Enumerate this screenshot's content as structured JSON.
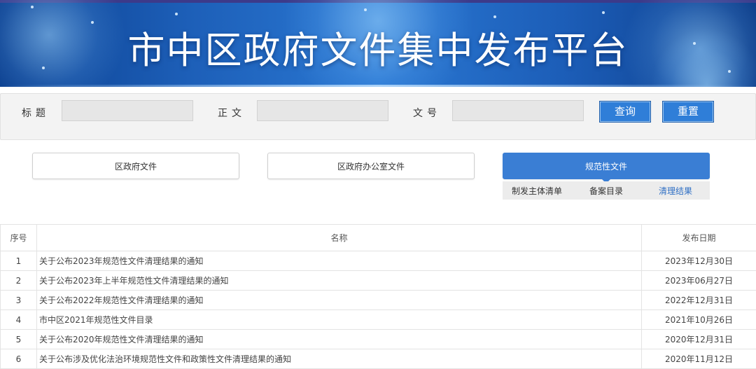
{
  "banner": {
    "title": "市中区政府文件集中发布平台"
  },
  "search": {
    "title_label": "标题",
    "body_label": "正文",
    "docno_label": "文号",
    "query_button": "查询",
    "reset_button": "重置"
  },
  "categories": {
    "tab1": "区政府文件",
    "tab2": "区政府办公室文件",
    "tab3": "规范性文件",
    "subtabs": [
      "制发主体清单",
      "备案目录",
      "清理结果"
    ],
    "active_subtab": "清理结果"
  },
  "table": {
    "headers": {
      "num": "序号",
      "name": "名称",
      "date": "发布日期"
    },
    "rows": [
      {
        "num": "1",
        "name": "关于公布2023年规范性文件清理结果的通知",
        "date": "2023年12月30日"
      },
      {
        "num": "2",
        "name": "关于公布2023年上半年规范性文件清理结果的通知",
        "date": "2023年06月27日"
      },
      {
        "num": "3",
        "name": "关于公布2022年规范性文件清理结果的通知",
        "date": "2022年12月31日"
      },
      {
        "num": "4",
        "name": "市中区2021年规范性文件目录",
        "date": "2021年10月26日"
      },
      {
        "num": "5",
        "name": "关于公布2020年规范性文件清理结果的通知",
        "date": "2020年12月31日"
      },
      {
        "num": "6",
        "name": "关于公布涉及优化法治环境规范性文件和政策性文件清理结果的通知",
        "date": "2020年11月12日"
      }
    ]
  },
  "colors": {
    "banner_blue": "#1d5fb8",
    "active_tab": "#3a7ed4",
    "button_blue": "#2f7ed8",
    "active_subtab_text": "#2f6fc4"
  }
}
